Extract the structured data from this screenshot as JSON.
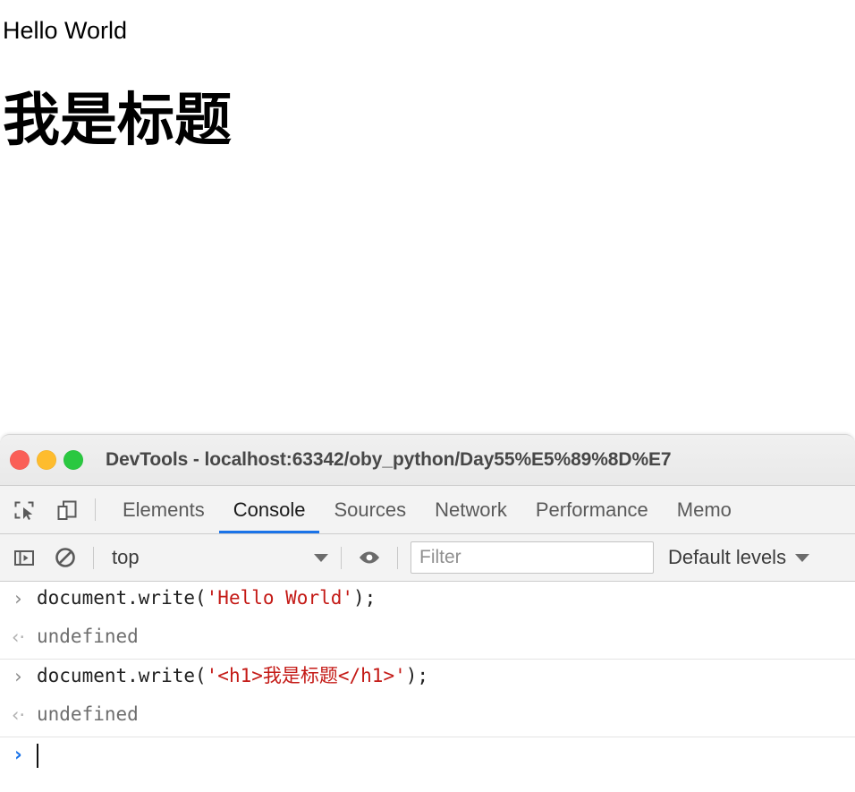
{
  "page": {
    "text": "Hello World",
    "heading": "我是标题"
  },
  "window": {
    "title": "DevTools - localhost:63342/oby_python/Day55%E5%89%8D%E7",
    "controls": {
      "close": "close-button",
      "minimize": "minimize-button",
      "maximize": "maximize-button"
    },
    "colors": {
      "close": "#fa5f57",
      "minimize": "#febc2e",
      "maximize": "#2ac840",
      "accent": "#1a73e8",
      "string": "#c41a16",
      "toolbar_bg": "#f3f3f3"
    }
  },
  "tabbar": {
    "inspect_icon": "inspect-cursor-icon",
    "device_icon": "device-toolbar-icon",
    "tabs": [
      {
        "label": "Elements",
        "active": false
      },
      {
        "label": "Console",
        "active": true
      },
      {
        "label": "Sources",
        "active": false
      },
      {
        "label": "Network",
        "active": false
      },
      {
        "label": "Performance",
        "active": false
      },
      {
        "label": "Memo",
        "active": false
      }
    ]
  },
  "console_toolbar": {
    "sidebar_icon": "console-sidebar-icon",
    "clear_icon": "clear-console-icon",
    "context": "top",
    "context_caret": "chevron-down-icon",
    "eye_icon": "live-expression-eye-icon",
    "filter_placeholder": "Filter",
    "filter_value": "",
    "levels_label": "Default levels",
    "levels_caret": "chevron-down-icon"
  },
  "console_rows": [
    {
      "kind": "input",
      "marker": "›",
      "prefix": "document.write(",
      "string": "'Hello World'",
      "suffix": ");"
    },
    {
      "kind": "result",
      "marker": "‹·",
      "value": "undefined"
    },
    {
      "kind": "input",
      "marker": "›",
      "prefix": "document.write(",
      "string": "'<h1>我是标题</h1>'",
      "suffix": ");"
    },
    {
      "kind": "result",
      "marker": "‹·",
      "value": "undefined"
    }
  ],
  "prompt": {
    "marker": "›",
    "value": ""
  }
}
